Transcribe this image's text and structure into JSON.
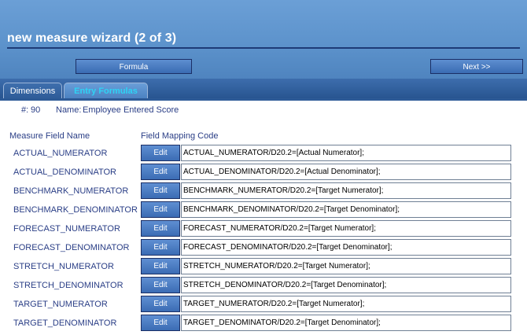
{
  "header": {
    "title": "new measure wizard (2 of 3)",
    "formula_label": "Formula",
    "next_label": "Next >>"
  },
  "tabs": [
    {
      "label": "Dimensions",
      "active": false
    },
    {
      "label": "Entry Formulas",
      "active": true
    }
  ],
  "info": {
    "number_label": "#:",
    "number": "90",
    "name_label": "Name:",
    "name": "Employee Entered Score"
  },
  "columns": {
    "field": "Measure Field Name",
    "code": "Field Mapping Code"
  },
  "edit_label": "Edit",
  "rows": [
    {
      "field": "ACTUAL_NUMERATOR",
      "code": "ACTUAL_NUMERATOR/D20.2=[Actual Numerator];"
    },
    {
      "field": "ACTUAL_DENOMINATOR",
      "code": "ACTUAL_DENOMINATOR/D20.2=[Actual Denominator];"
    },
    {
      "field": "BENCHMARK_NUMERATOR",
      "code": "BENCHMARK_NUMERATOR/D20.2=[Target Numerator];"
    },
    {
      "field": "BENCHMARK_DENOMINATOR",
      "code": "BENCHMARK_DENOMINATOR/D20.2=[Target Denominator];"
    },
    {
      "field": "FORECAST_NUMERATOR",
      "code": "FORECAST_NUMERATOR/D20.2=[Target Numerator];"
    },
    {
      "field": "FORECAST_DENOMINATOR",
      "code": "FORECAST_DENOMINATOR/D20.2=[Target Denominator];"
    },
    {
      "field": "STRETCH_NUMERATOR",
      "code": "STRETCH_NUMERATOR/D20.2=[Target Numerator];"
    },
    {
      "field": "STRETCH_DENOMINATOR",
      "code": "STRETCH_DENOMINATOR/D20.2=[Target Denominator];"
    },
    {
      "field": "TARGET_NUMERATOR",
      "code": "TARGET_NUMERATOR/D20.2=[Target Numerator];"
    },
    {
      "field": "TARGET_DENOMINATOR",
      "code": "TARGET_DENOMINATOR/D20.2=[Target Denominator];"
    }
  ]
}
